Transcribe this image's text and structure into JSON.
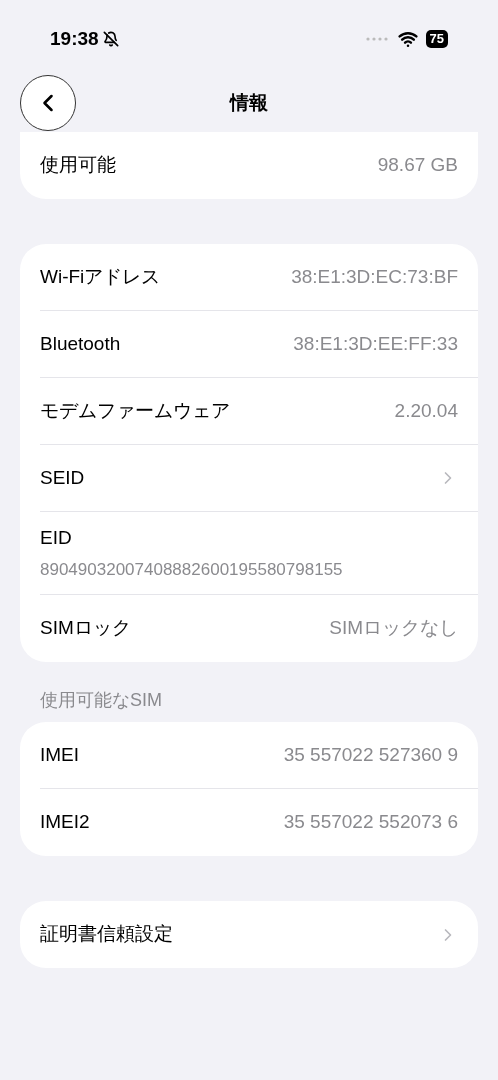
{
  "status_bar": {
    "time": "19:38",
    "silent": true,
    "battery": "75"
  },
  "nav": {
    "title": "情報"
  },
  "groups": [
    {
      "rows": [
        {
          "kind": "value",
          "label": "使用可能",
          "value": "98.67 GB"
        }
      ]
    },
    {
      "rows": [
        {
          "kind": "value",
          "label": "Wi-Fiアドレス",
          "value": "38:E1:3D:EC:73:BF"
        },
        {
          "kind": "value",
          "label": "Bluetooth",
          "value": "38:E1:3D:EE:FF:33"
        },
        {
          "kind": "value",
          "label": "モデムファームウェア",
          "value": "2.20.04"
        },
        {
          "kind": "link",
          "label": "SEID"
        },
        {
          "kind": "stacked",
          "label": "EID",
          "value": "89049032007408882600195580798155"
        },
        {
          "kind": "value",
          "label": "SIMロック",
          "value": "SIMロックなし"
        }
      ]
    },
    {
      "header": "使用可能なSIM",
      "rows": [
        {
          "kind": "value",
          "label": "IMEI",
          "value": "35 557022 527360 9"
        },
        {
          "kind": "value",
          "label": "IMEI2",
          "value": "35 557022 552073 6"
        }
      ]
    },
    {
      "rows": [
        {
          "kind": "link",
          "label": "証明書信頼設定"
        }
      ]
    }
  ]
}
